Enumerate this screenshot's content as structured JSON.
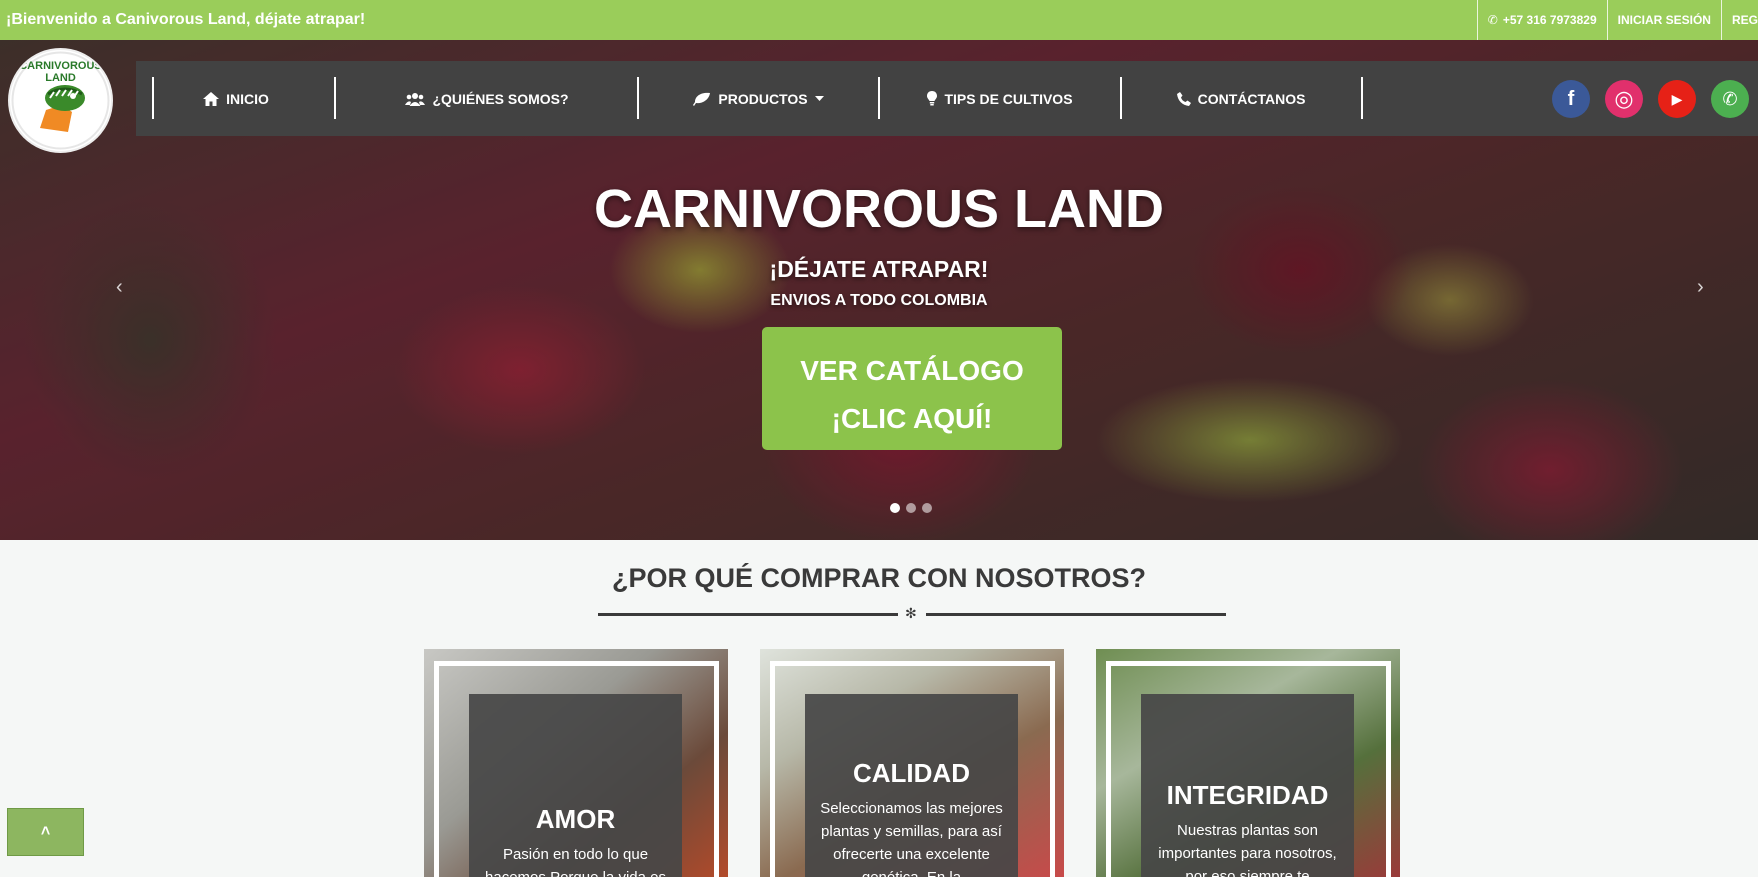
{
  "topbar": {
    "welcome": "¡Bienvenido a Canivorous Land, déjate atrapar!",
    "phone": "+57 316 7973829",
    "login": "INICIAR SESIÓN",
    "register": "REG"
  },
  "logo": {
    "text": "CARNIVOROUS LAND"
  },
  "nav": {
    "items": [
      {
        "label": "INICIO",
        "icon": "home-icon"
      },
      {
        "label": "¿QUIÉNES SOMOS?",
        "icon": "users-icon"
      },
      {
        "label": "PRODUCTOS",
        "icon": "leaf-icon"
      },
      {
        "label": "TIPS DE CULTIVOS",
        "icon": "lightbulb-icon"
      },
      {
        "label": "CONTÁCTANOS",
        "icon": "phone-icon"
      }
    ],
    "social": [
      {
        "name": "facebook-icon",
        "glyph": "f",
        "color": "#3b5998"
      },
      {
        "name": "instagram-icon",
        "glyph": "◎",
        "color": "#e1306c"
      },
      {
        "name": "youtube-icon",
        "glyph": "▶",
        "color": "#e62117"
      },
      {
        "name": "whatsapp-icon",
        "glyph": "✆",
        "color": "#4caf50"
      }
    ]
  },
  "hero": {
    "title": "CARNIVOROUS LAND",
    "subtitle": "¡DÉJATE ATRAPAR!",
    "subtitle2": "ENVIOS A TODO COLOMBIA",
    "cta_line1": "VER CATÁLOGO",
    "cta_line2": "¡CLIC AQUÍ!",
    "prev": "‹",
    "next": "›"
  },
  "section": {
    "title": "¿POR QUÉ COMPRAR CON NOSOTROS?",
    "ornament": "✻"
  },
  "cards": [
    {
      "title": "AMOR",
      "desc": "Pasión en todo lo que hacemos Porque la vida es"
    },
    {
      "title": "CALIDAD",
      "desc": "Seleccionamos las mejores plantas y semillas, para así ofrecerte una excelente genética. En la"
    },
    {
      "title": "INTEGRIDAD",
      "desc": "Nuestras plantas son importantes para nosotros, por eso siempre te"
    }
  ],
  "back_to_top": "˄",
  "colors": {
    "brand_green": "#8cc34b",
    "topbar_green": "#9acd5a",
    "nav_bg": "#424242"
  }
}
